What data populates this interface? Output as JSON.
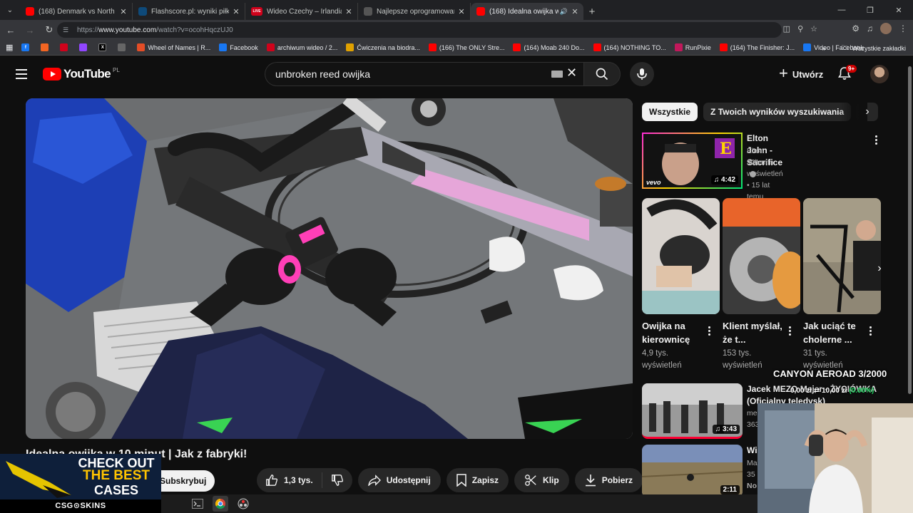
{
  "browser": {
    "tabs": [
      {
        "title": "(168) Denmark vs North Macedonia",
        "favicon_color": "#ff0000",
        "active": false
      },
      {
        "title": "Flashscore.pl: wyniki piłki nożnej",
        "favicon_color": "#0e4a7a",
        "active": false
      },
      {
        "title": "Wideo Czechy – Irlandia. Highlights",
        "favicon_color": "#d0021b",
        "favicon_text": "LIVE",
        "active": false
      },
      {
        "title": "Najlepsze oprogramowanie do",
        "favicon_color": "#555555",
        "active": false
      },
      {
        "title": "(168) Idealna owijka w 10 m",
        "favicon_color": "#ff0000",
        "active": true
      }
    ],
    "url_prefix": "https://",
    "url_host": "www.youtube.com",
    "url_path": "/watch?v=ocohHqczUJ0",
    "bookmarks": [
      {
        "label": "Wheel of Names | R...",
        "color": "#e44d26"
      },
      {
        "label": "Facebook",
        "color": "#1877f2"
      },
      {
        "label": "archiwum wideo / 2...",
        "color": "#d0021b"
      },
      {
        "label": "Ćwiczenia na biodra...",
        "color": "#e0a100"
      },
      {
        "label": "(166) The ONLY Stre...",
        "color": "#ff0000"
      },
      {
        "label": "(164) Moab 240 Do...",
        "color": "#ff0000"
      },
      {
        "label": "(164) NOTHING TO...",
        "color": "#ff0000"
      },
      {
        "label": "RunPixie",
        "color": "#c2185b"
      },
      {
        "label": "(164) The Finisher: J...",
        "color": "#ff0000"
      },
      {
        "label": "Video | Facebook",
        "color": "#1877f2"
      }
    ],
    "all_bookmarks": "Wszystkie zakładki"
  },
  "masthead": {
    "logo_text": "YouTube",
    "country": "PL",
    "search_value": "unbroken reed owijka",
    "create_label": "Utwórz",
    "notification_count": "9+"
  },
  "video": {
    "title": "Idealna owijka w 10 minut | Jak z fabryki!",
    "subscribe_label": "Subskrybuj",
    "likes": "1,3 tys.",
    "share_label": "Udostępnij",
    "save_label": "Zapisz",
    "clip_label": "Klip",
    "download_label": "Pobierz"
  },
  "sidebar": {
    "chips": [
      "Wszystkie",
      "Z Twoich wyników wyszukiwania"
    ],
    "featured": {
      "title": "Elton John - Sacrifice",
      "channel": "Elton John",
      "meta": "921 mln wyświetleń • 15 lat temu",
      "duration": "4:42",
      "vevo": "vevo"
    },
    "shorts": [
      {
        "title": "Owijka na kierownicę",
        "views": "4,9 tys. wyświetleń"
      },
      {
        "title": "Klient myślał, że t...",
        "views": "153 tys. wyświetleń"
      },
      {
        "title": "Jak uciąć te cholerne ...",
        "views": "31 tys. wyświetleń"
      }
    ],
    "list": [
      {
        "title": "Jacek MEZO Mejer - ŻYCIÓWKA (Oficjalny teledysk)",
        "channel": "me",
        "meta": "363",
        "duration": "3:43"
      },
      {
        "title": "Wi",
        "channel": "Ma",
        "meta": "35",
        "extra": "No",
        "duration": "2:11"
      }
    ]
  },
  "overlay": {
    "ad_line1": "CHECK OUT",
    "ad_line2": "THE BEST",
    "ad_line3": "CASES",
    "ad_brand": "CSG⊙SKINS",
    "stream_title": "CANYON AEROAD 3/2000",
    "stream_stats": "0,00 zł ⇄ 10,00 zł",
    "stream_pct": "(0.00%)"
  }
}
